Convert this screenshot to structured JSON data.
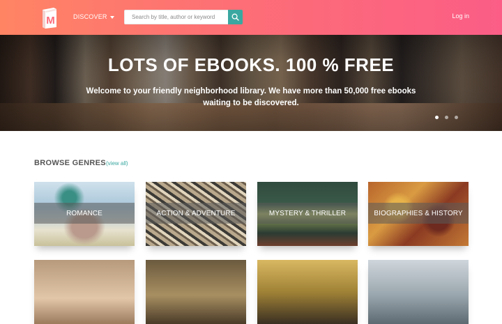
{
  "header": {
    "discover_label": "DISCOVER",
    "search_placeholder": "Search by title, author or keyword",
    "login_label": "Log in",
    "logo_letter": "M",
    "icons": {
      "logo": "book-m-logo",
      "search": "search-icon",
      "caret": "caret-down-icon"
    },
    "colors": {
      "gradient_start": "#ff8464",
      "gradient_end": "#fb5d86",
      "search_button": "#3aa8a0"
    }
  },
  "hero": {
    "title": "LOTS OF EBOOKS. 100 % FREE",
    "subtitle": "Welcome to your friendly neighborhood library. We have more than 50,000 free ebooks waiting to be discovered.",
    "carousel": {
      "slide_count": 3,
      "active_index": 0
    }
  },
  "genres": {
    "title": "BROWSE GENRES",
    "view_all_label": "(view all)",
    "accent_color": "#3aa8a0",
    "items": [
      {
        "label": "ROMANCE"
      },
      {
        "label": "ACTION & ADVENTURE"
      },
      {
        "label": "MYSTERY & THRILLER"
      },
      {
        "label": "BIOGRAPHIES & HISTORY"
      }
    ]
  }
}
